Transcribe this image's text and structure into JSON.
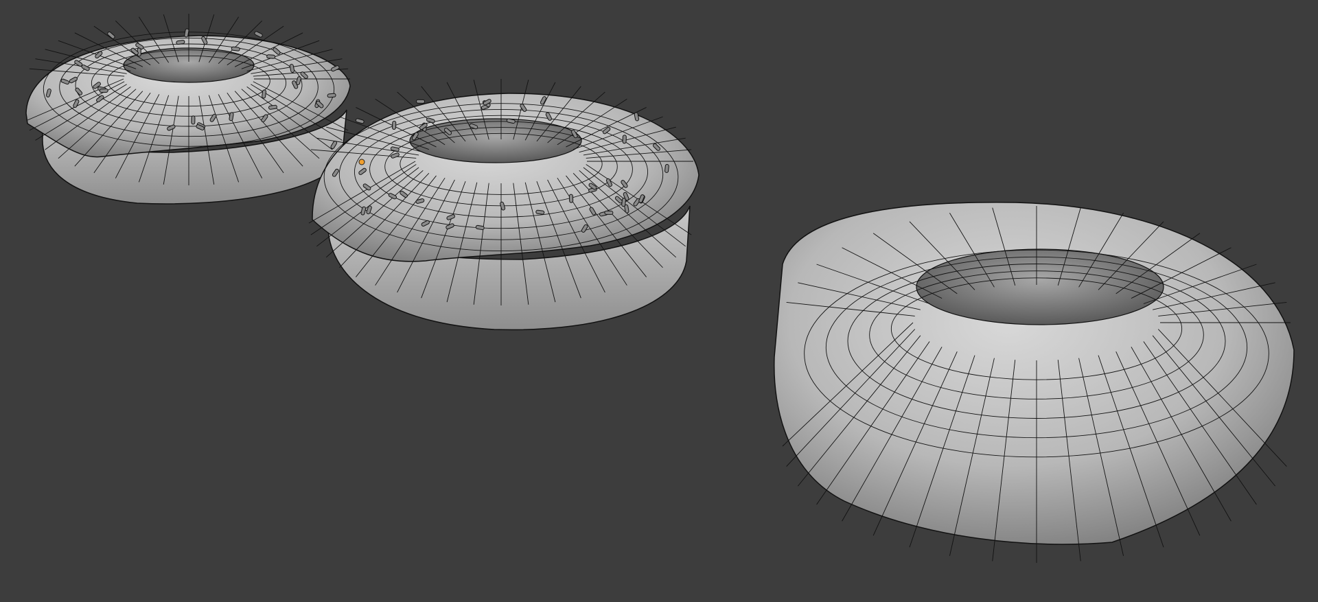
{
  "viewport": {
    "background_color": "#3d3d3d",
    "shading_mode": "solid-with-wireframe-overlay"
  },
  "colors": {
    "surface_light": "#d4d4d4",
    "surface_mid": "#b5b5b5",
    "surface_dark": "#7a7a7a",
    "wire": "#111111",
    "origin_marker": "#f0a030"
  },
  "objects": [
    {
      "name_icon": "donut-icing-mesh-icon",
      "kind": "donut-with-icing-and-sprinkles",
      "selected": false
    },
    {
      "name_icon": "donut-icing-mesh-icon",
      "kind": "donut-with-icing-and-sprinkles",
      "selected": true
    },
    {
      "name_icon": "torus-mesh-icon",
      "kind": "plain-torus",
      "selected": false
    }
  ]
}
